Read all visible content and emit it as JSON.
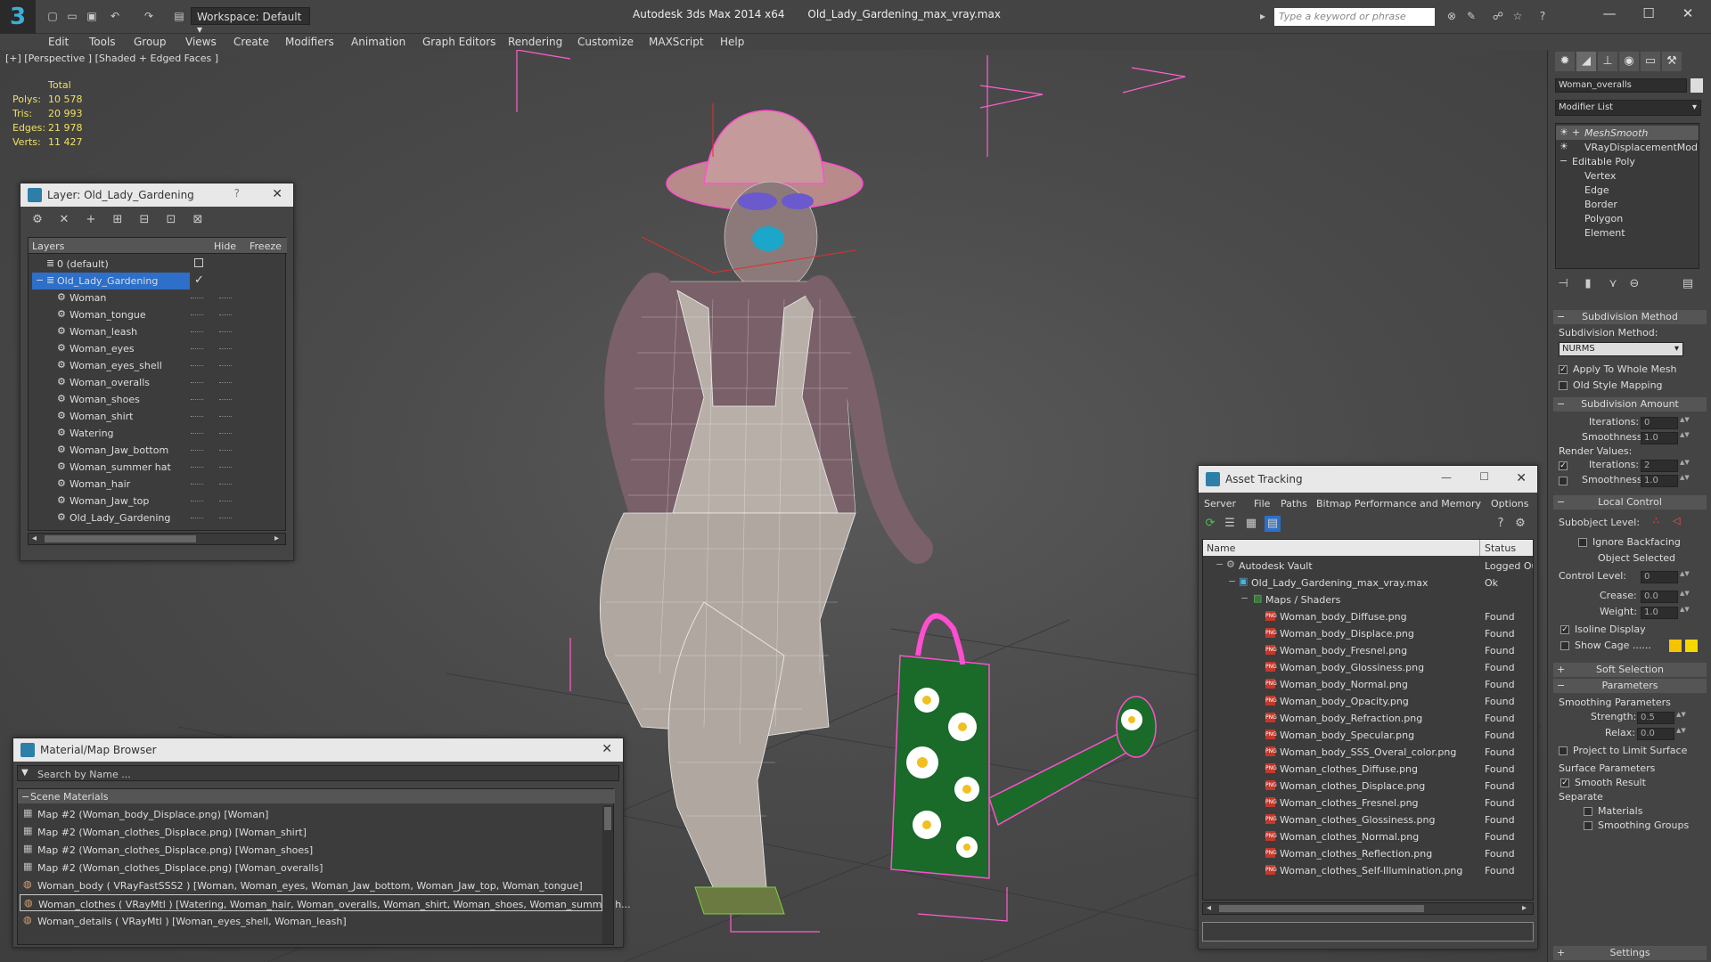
{
  "app": {
    "title": "Autodesk 3ds Max  2014 x64",
    "file": "Old_Lady_Gardening_max_vray.max",
    "workspace": "Workspace: Default",
    "search_placeholder": "Type a keyword or phrase"
  },
  "menu": [
    "Edit",
    "Tools",
    "Group",
    "Views",
    "Create",
    "Modifiers",
    "Animation",
    "Graph Editors",
    "Rendering",
    "Customize",
    "MAXScript",
    "Help"
  ],
  "viewport": {
    "label": "[+] [Perspective ] [Shaded + Edged Faces ]",
    "stats": {
      "header": "Total",
      "polys_label": "Polys:",
      "polys": "10 578",
      "tris_label": "Tris:",
      "tris": "20 993",
      "edges_label": "Edges:",
      "edges": "21 978",
      "verts_label": "Verts:",
      "verts": "11 427"
    }
  },
  "layer_panel": {
    "title": "Layer: Old_Lady_Gardening",
    "help": "?",
    "col_layers": "Layers",
    "col_hide": "Hide",
    "col_freeze": "Freeze",
    "layers": [
      "0 (default)",
      "Old_Lady_Gardening"
    ],
    "objects": [
      "Woman",
      "Woman_tongue",
      "Woman_leash",
      "Woman_eyes",
      "Woman_eyes_shell",
      "Woman_overalls",
      "Woman_shoes",
      "Woman_shirt",
      "Watering",
      "Woman_Jaw_bottom",
      "Woman_summer hat",
      "Woman_hair",
      "Woman_Jaw_top",
      "Old_Lady_Gardening"
    ]
  },
  "material_browser": {
    "title": "Material/Map Browser",
    "search_placeholder": "Search by Name ...",
    "section": "Scene Materials",
    "items": [
      "Map #2 (Woman_body_Displace.png) [Woman]",
      "Map #2 (Woman_clothes_Displace.png) [Woman_shirt]",
      "Map #2 (Woman_clothes_Displace.png) [Woman_shoes]",
      "Map #2 (Woman_clothes_Displace.png) [Woman_overalls]",
      "Woman_body  ( VRayFastSSS2 )  [Woman, Woman_eyes, Woman_Jaw_bottom, Woman_Jaw_top, Woman_tongue]",
      "Woman_clothes  ( VRayMtl )  [Watering, Woman_hair, Woman_overalls, Woman_shirt, Woman_shoes, Woman_summer h...",
      "Woman_details  ( VRayMtl )  [Woman_eyes_shell, Woman_leash]"
    ]
  },
  "asset_tracking": {
    "title": "Asset Tracking",
    "menu": [
      "Server",
      "File",
      "Paths",
      "Bitmap Performance and Memory",
      "Options"
    ],
    "col_name": "Name",
    "col_status": "Status",
    "vault": "Autodesk Vault",
    "vault_status": "Logged Ou",
    "file": "Old_Lady_Gardening_max_vray.max",
    "file_status": "Ok",
    "group": "Maps / Shaders",
    "assets": [
      "Woman_body_Diffuse.png",
      "Woman_body_Displace.png",
      "Woman_body_Fresnel.png",
      "Woman_body_Glossiness.png",
      "Woman_body_Normal.png",
      "Woman_body_Opacity.png",
      "Woman_body_Refraction.png",
      "Woman_body_Specular.png",
      "Woman_body_SSS_Overal_color.png",
      "Woman_clothes_Diffuse.png",
      "Woman_clothes_Displace.png",
      "Woman_clothes_Fresnel.png",
      "Woman_clothes_Glossiness.png",
      "Woman_clothes_Normal.png",
      "Woman_clothes_Reflection.png",
      "Woman_clothes_Self-Illumination.png"
    ],
    "asset_status": "Found"
  },
  "command_panel": {
    "object_name": "Woman_overalls",
    "modifier_list": "Modifier List",
    "stack": [
      "MeshSmooth",
      "VRayDisplacementMod",
      "Editable Poly",
      "Vertex",
      "Edge",
      "Border",
      "Polygon",
      "Element"
    ],
    "subdivision_method_title": "Subdivision Method",
    "subdivision_method_label": "Subdivision Method:",
    "subdivision_method_value": "NURMS",
    "apply_whole_mesh": "Apply To Whole Mesh",
    "old_style_mapping": "Old Style Mapping",
    "subdivision_amount_title": "Subdivision Amount",
    "iterations_label": "Iterations:",
    "iterations_value": "0",
    "smoothness_label": "Smoothness:",
    "smoothness_value": "1.0",
    "render_values_label": "Render Values:",
    "render_iterations_value": "2",
    "render_smoothness_value": "1.0",
    "local_control_title": "Local Control",
    "subobject_level_label": "Subobject Level:",
    "ignore_backfacing": "Ignore Backfacing",
    "object_selected": "Object Selected",
    "control_level_label": "Control Level:",
    "control_level_value": "0",
    "crease_label": "Crease:",
    "crease_value": "0.0",
    "weight_label": "Weight:",
    "weight_value": "1.0",
    "isoline_display": "Isoline Display",
    "show_cage": "Show Cage ......",
    "soft_selection_title": "Soft Selection",
    "parameters_title": "Parameters",
    "smoothing_parameters": "Smoothing Parameters",
    "strength_label": "Strength:",
    "strength_value": "0.5",
    "relax_label": "Relax:",
    "relax_value": "0.0",
    "project_limit": "Project to Limit Surface",
    "surface_parameters": "Surface Parameters",
    "smooth_result": "Smooth Result",
    "separate": "Separate",
    "materials": "Materials",
    "smoothing_groups": "Smoothing Groups",
    "settings_title": "Settings"
  },
  "colors": {
    "selection": "#2d6fc9",
    "stats_text": "#f0e060",
    "wire_pink": "#ff4fd0",
    "cage_yellow": "#f5c400"
  }
}
